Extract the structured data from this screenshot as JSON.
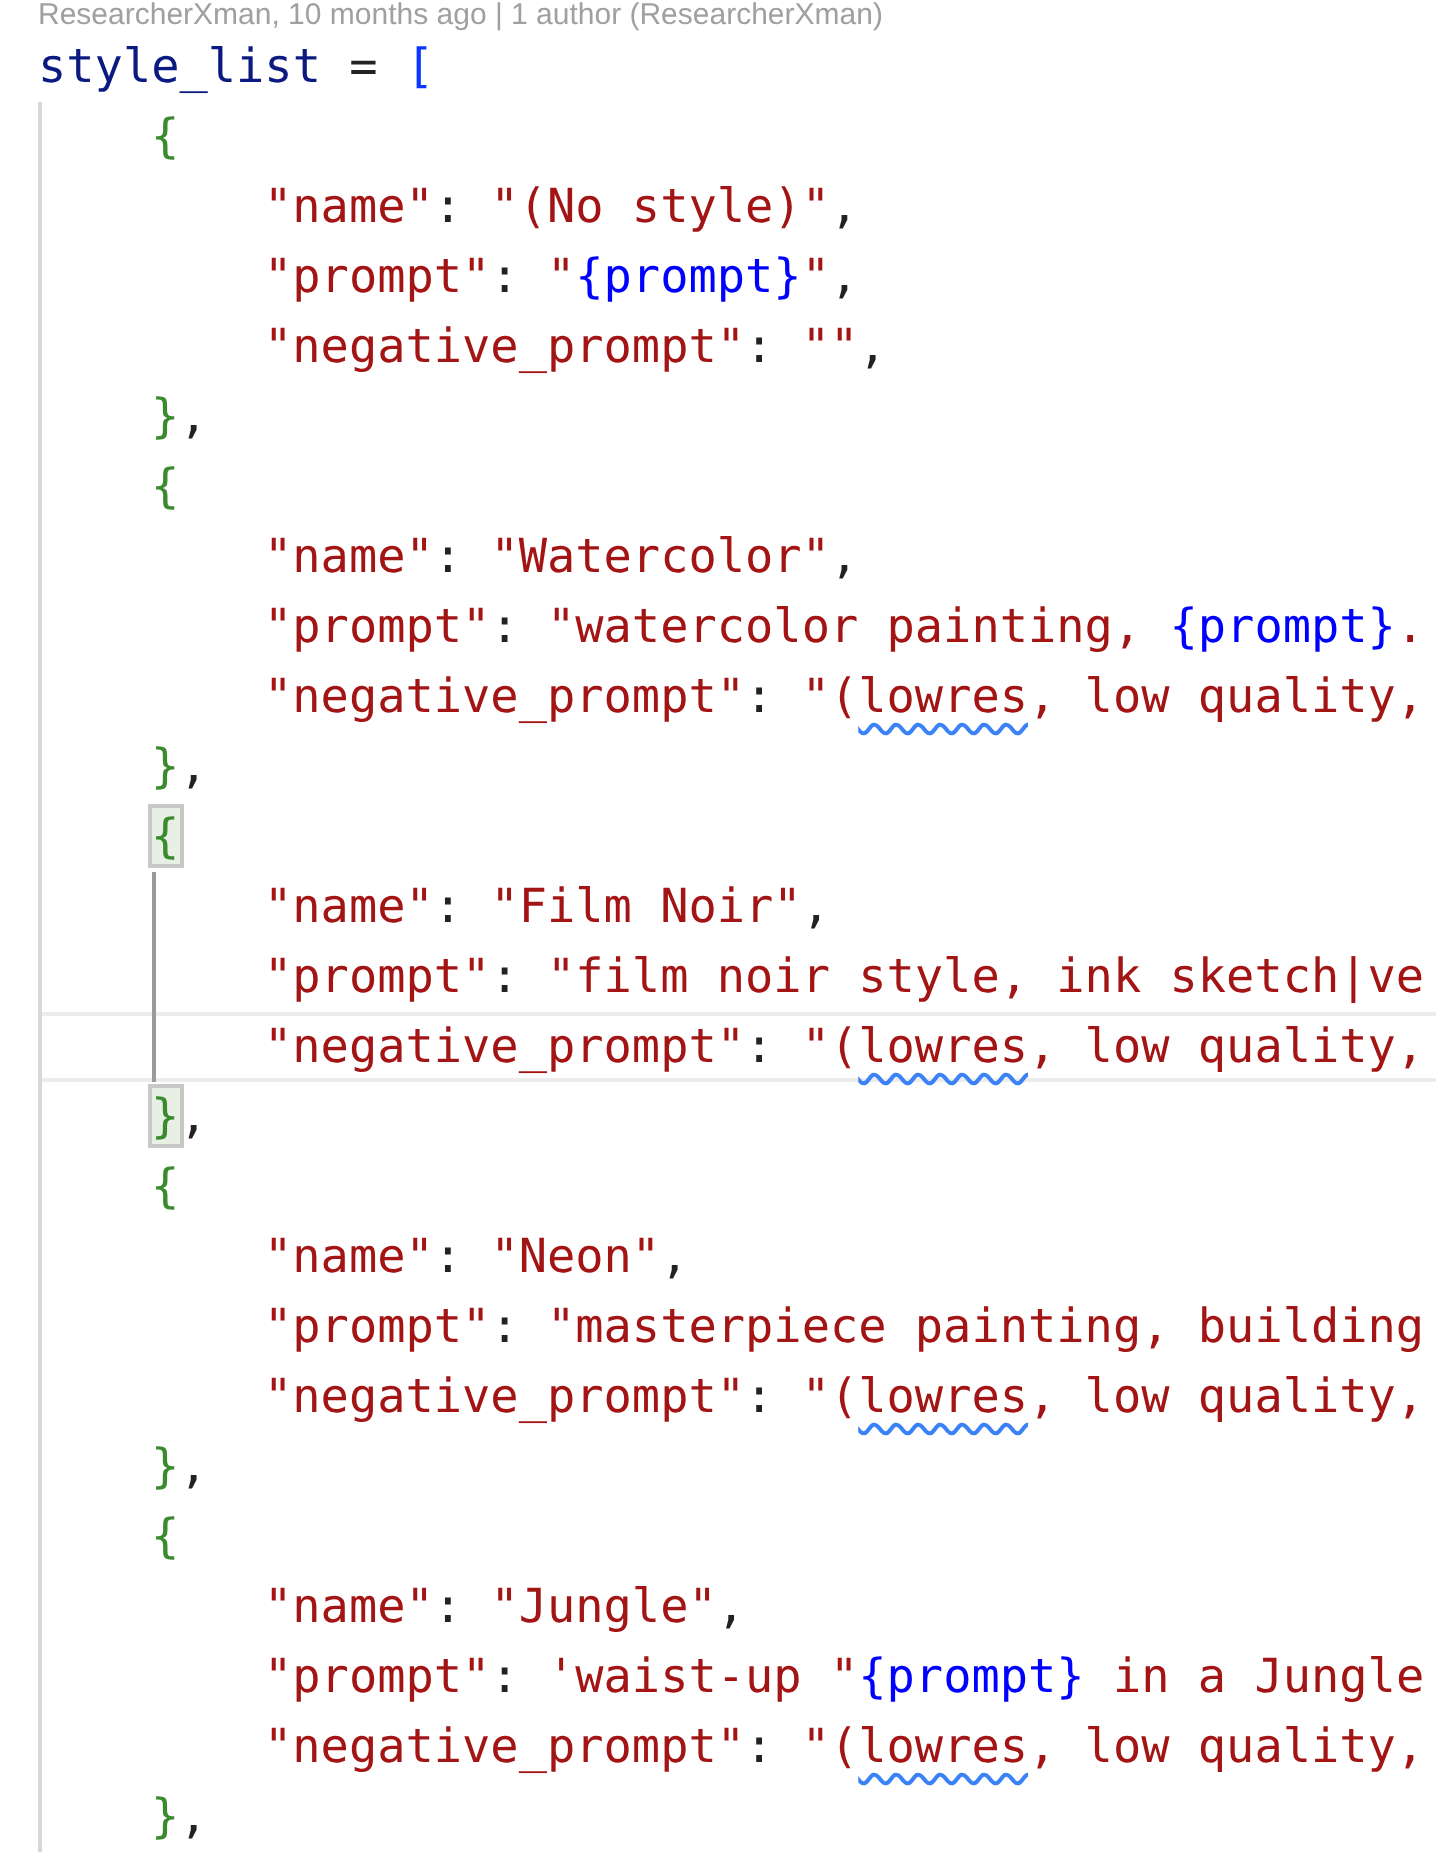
{
  "blame": "ResearcherXman, 10 months ago | 1 author (ResearcherXman)",
  "lines": [
    {
      "kind": "statement",
      "current": false,
      "tokens": [
        {
          "kind": "ident",
          "text": "style_list"
        },
        {
          "kind": "op",
          "text": " = "
        },
        {
          "kind": "bracket",
          "text": "["
        }
      ]
    },
    {
      "kind": "brace",
      "current": false,
      "tokens": [
        {
          "kind": "brace",
          "text": "{",
          "matched": false
        }
      ]
    },
    {
      "kind": "field",
      "current": false,
      "tokens": [
        {
          "kind": "str",
          "text": "\"name\""
        },
        {
          "kind": "op",
          "text": ": "
        },
        {
          "kind": "str",
          "text": "\"(No style)\""
        },
        {
          "kind": "op",
          "text": ","
        }
      ]
    },
    {
      "kind": "field",
      "current": false,
      "tokens": [
        {
          "kind": "str",
          "text": "\"prompt\""
        },
        {
          "kind": "op",
          "text": ": "
        },
        {
          "kind": "str",
          "text": "\""
        },
        {
          "kind": "interp",
          "text": "{prompt}"
        },
        {
          "kind": "str",
          "text": "\""
        },
        {
          "kind": "op",
          "text": ","
        }
      ]
    },
    {
      "kind": "field",
      "current": false,
      "tokens": [
        {
          "kind": "str",
          "text": "\"negative_prompt\""
        },
        {
          "kind": "op",
          "text": ": "
        },
        {
          "kind": "str",
          "text": "\"\""
        },
        {
          "kind": "op",
          "text": ","
        }
      ]
    },
    {
      "kind": "brace",
      "current": false,
      "tokens": [
        {
          "kind": "brace",
          "text": "}",
          "matched": false
        },
        {
          "kind": "op",
          "text": ","
        }
      ]
    },
    {
      "kind": "brace",
      "current": false,
      "tokens": [
        {
          "kind": "brace",
          "text": "{",
          "matched": false
        }
      ]
    },
    {
      "kind": "field",
      "current": false,
      "tokens": [
        {
          "kind": "str",
          "text": "\"name\""
        },
        {
          "kind": "op",
          "text": ": "
        },
        {
          "kind": "str",
          "text": "\"Watercolor\""
        },
        {
          "kind": "op",
          "text": ","
        }
      ]
    },
    {
      "kind": "field",
      "current": false,
      "tokens": [
        {
          "kind": "str",
          "text": "\"prompt\""
        },
        {
          "kind": "op",
          "text": ": "
        },
        {
          "kind": "str",
          "text": "\"watercolor painting, "
        },
        {
          "kind": "interp",
          "text": "{prompt}"
        },
        {
          "kind": "str",
          "text": "."
        }
      ]
    },
    {
      "kind": "field",
      "current": false,
      "tokens": [
        {
          "kind": "str",
          "text": "\"negative_prompt\""
        },
        {
          "kind": "op",
          "text": ": "
        },
        {
          "kind": "str",
          "text": "\"("
        },
        {
          "kind": "spell",
          "text": "lowres"
        },
        {
          "kind": "str",
          "text": ", low quality,"
        }
      ]
    },
    {
      "kind": "brace",
      "current": false,
      "tokens": [
        {
          "kind": "brace",
          "text": "}",
          "matched": false
        },
        {
          "kind": "op",
          "text": ","
        }
      ]
    },
    {
      "kind": "brace",
      "current": false,
      "tokens": [
        {
          "kind": "brace",
          "text": "{",
          "matched": true
        }
      ]
    },
    {
      "kind": "field",
      "current": false,
      "tokens": [
        {
          "kind": "str",
          "text": "\"name\""
        },
        {
          "kind": "op",
          "text": ": "
        },
        {
          "kind": "str",
          "text": "\"Film Noir\""
        },
        {
          "kind": "op",
          "text": ","
        }
      ]
    },
    {
      "kind": "field",
      "current": false,
      "tokens": [
        {
          "kind": "str",
          "text": "\"prompt\""
        },
        {
          "kind": "op",
          "text": ": "
        },
        {
          "kind": "str",
          "text": "\"film noir style, ink sketch|ve"
        }
      ]
    },
    {
      "kind": "field",
      "current": true,
      "tokens": [
        {
          "kind": "str",
          "text": "\"negative_prompt\""
        },
        {
          "kind": "op",
          "text": ": "
        },
        {
          "kind": "str",
          "text": "\"("
        },
        {
          "kind": "spell",
          "text": "lowres"
        },
        {
          "kind": "str",
          "text": ", low quality,"
        }
      ]
    },
    {
      "kind": "brace",
      "current": false,
      "tokens": [
        {
          "kind": "brace",
          "text": "}",
          "matched": true
        },
        {
          "kind": "op",
          "text": ","
        }
      ]
    },
    {
      "kind": "brace",
      "current": false,
      "tokens": [
        {
          "kind": "brace",
          "text": "{",
          "matched": false
        }
      ]
    },
    {
      "kind": "field",
      "current": false,
      "tokens": [
        {
          "kind": "str",
          "text": "\"name\""
        },
        {
          "kind": "op",
          "text": ": "
        },
        {
          "kind": "str",
          "text": "\"Neon\""
        },
        {
          "kind": "op",
          "text": ","
        }
      ]
    },
    {
      "kind": "field",
      "current": false,
      "tokens": [
        {
          "kind": "str",
          "text": "\"prompt\""
        },
        {
          "kind": "op",
          "text": ": "
        },
        {
          "kind": "str",
          "text": "\"masterpiece painting, building"
        }
      ]
    },
    {
      "kind": "field",
      "current": false,
      "tokens": [
        {
          "kind": "str",
          "text": "\"negative_prompt\""
        },
        {
          "kind": "op",
          "text": ": "
        },
        {
          "kind": "str",
          "text": "\"("
        },
        {
          "kind": "spell",
          "text": "lowres"
        },
        {
          "kind": "str",
          "text": ", low quality,"
        }
      ]
    },
    {
      "kind": "brace",
      "current": false,
      "tokens": [
        {
          "kind": "brace",
          "text": "}",
          "matched": false
        },
        {
          "kind": "op",
          "text": ","
        }
      ]
    },
    {
      "kind": "brace",
      "current": false,
      "tokens": [
        {
          "kind": "brace",
          "text": "{",
          "matched": false
        }
      ]
    },
    {
      "kind": "field",
      "current": false,
      "tokens": [
        {
          "kind": "str",
          "text": "\"name\""
        },
        {
          "kind": "op",
          "text": ": "
        },
        {
          "kind": "str",
          "text": "\"Jungle\""
        },
        {
          "kind": "op",
          "text": ","
        }
      ]
    },
    {
      "kind": "field",
      "current": false,
      "tokens": [
        {
          "kind": "str",
          "text": "\"prompt\""
        },
        {
          "kind": "op",
          "text": ": "
        },
        {
          "kind": "str",
          "text": "'waist-up \""
        },
        {
          "kind": "interp",
          "text": "{prompt}"
        },
        {
          "kind": "str",
          "text": " in a Jungle"
        }
      ]
    },
    {
      "kind": "field",
      "current": false,
      "tokens": [
        {
          "kind": "str",
          "text": "\"negative_prompt\""
        },
        {
          "kind": "op",
          "text": ": "
        },
        {
          "kind": "str",
          "text": "\"("
        },
        {
          "kind": "spell",
          "text": "lowres"
        },
        {
          "kind": "str",
          "text": ", low quality,"
        }
      ]
    },
    {
      "kind": "brace",
      "current": false,
      "tokens": [
        {
          "kind": "brace",
          "text": "}",
          "matched": false
        },
        {
          "kind": "op",
          "text": ","
        }
      ]
    }
  ]
}
